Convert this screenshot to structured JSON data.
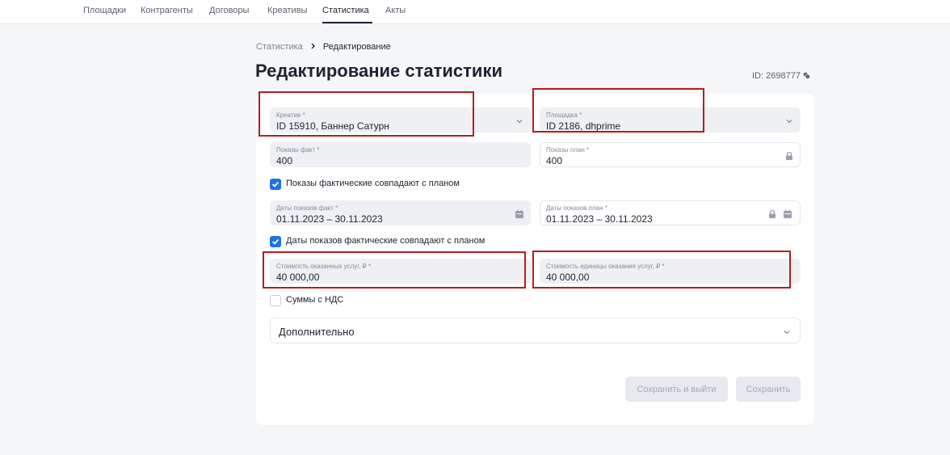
{
  "nav": {
    "items": [
      "Площадки",
      "Контрагенты",
      "Договоры",
      "Креативы",
      "Статистика",
      "Акты"
    ],
    "active": "Статистика"
  },
  "breadcrumb": {
    "parent": "Статистика",
    "current": "Редактирование"
  },
  "page": {
    "title": "Редактирование статистики",
    "id_label": "ID: 2698777"
  },
  "form": {
    "creative": {
      "label": "Креатив *",
      "value": "ID 15910, Баннер Сатурн"
    },
    "platform": {
      "label": "Площадка *",
      "value": "ID 2186, dhprime"
    },
    "impressions_fact": {
      "label": "Показы факт *",
      "value": "400"
    },
    "impressions_plan": {
      "label": "Показы план *",
      "value": "400"
    },
    "impressions_match": {
      "label": "Показы фактические совпадают с планом",
      "checked": true
    },
    "dates_fact": {
      "label": "Даты показов факт *",
      "value": "01.11.2023 – 30.11.2023"
    },
    "dates_plan": {
      "label": "Даты показов план *",
      "value": "01.11.2023 – 30.11.2023"
    },
    "dates_match": {
      "label": "Даты показов фактические совпадают с планом",
      "checked": true
    },
    "services_cost": {
      "label": "Стоимость оказанных услуг, ₽ *",
      "value": "40 000,00"
    },
    "unit_cost": {
      "label": "Стоимость единицы оказания услуг, ₽ *",
      "value": "40 000,00"
    },
    "vat": {
      "label": "Суммы с НДС",
      "checked": false
    },
    "additional": {
      "label": "Дополнительно"
    }
  },
  "actions": {
    "save_exit": "Сохранить и выйти",
    "save": "Сохранить"
  },
  "colors": {
    "accent": "#1a73e8",
    "highlight": "#b81c1c",
    "field_bg": "#eef0f4",
    "page_bg": "#f5f6f8"
  },
  "icons": [
    "chevron-right-icon",
    "copy-icon",
    "chevron-down-icon",
    "lock-icon",
    "calendar-icon",
    "check-icon"
  ]
}
